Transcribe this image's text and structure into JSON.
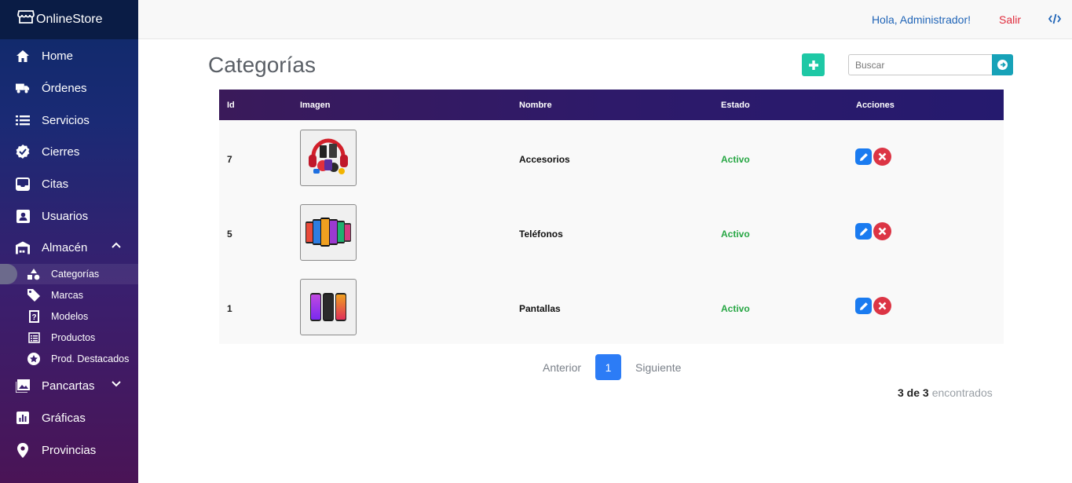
{
  "app": {
    "brand": "OnlineStore"
  },
  "colors": {
    "accent": "#1ec8a5",
    "primary": "#2c7cf6",
    "status_active": "#28a745",
    "danger": "#dc3545"
  },
  "sidebar": {
    "items": [
      {
        "label": "Home",
        "icon": "home-icon"
      },
      {
        "label": "Órdenes",
        "icon": "truck-icon"
      },
      {
        "label": "Servicios",
        "icon": "list-icon"
      },
      {
        "label": "Cierres",
        "icon": "badge-check-icon"
      },
      {
        "label": "Citas",
        "icon": "inbox-icon"
      },
      {
        "label": "Usuarios",
        "icon": "user-card-icon"
      },
      {
        "label": "Almacén",
        "icon": "warehouse-icon",
        "expanded": true
      },
      {
        "label": "Pancartas",
        "icon": "image-icon",
        "expanded": false
      },
      {
        "label": "Gráficas",
        "icon": "chart-icon"
      },
      {
        "label": "Provincias",
        "icon": "map-pin-icon"
      }
    ],
    "subitems": [
      {
        "label": "Categorías",
        "icon": "shapes-icon",
        "active": true
      },
      {
        "label": "Marcas",
        "icon": "tag-icon"
      },
      {
        "label": "Modelos",
        "icon": "box-question-icon"
      },
      {
        "label": "Productos",
        "icon": "list-alt-icon"
      },
      {
        "label": "Prod. Destacados",
        "icon": "star-circle-icon"
      }
    ]
  },
  "topbar": {
    "greeting": "Hola, Administrador!",
    "logout": "Salir"
  },
  "main": {
    "title": "Categorías",
    "search_placeholder": "Buscar",
    "table": {
      "headers": [
        "Id",
        "Imagen",
        "Nombre",
        "Estado",
        "Acciones"
      ],
      "rows": [
        {
          "id": "7",
          "name": "Accesorios",
          "status": "Activo",
          "image": "accessories-thumbnail"
        },
        {
          "id": "5",
          "name": "Teléfonos",
          "status": "Activo",
          "image": "phones-thumbnail"
        },
        {
          "id": "1",
          "name": "Pantallas",
          "status": "Activo",
          "image": "screens-thumbnail"
        }
      ]
    },
    "pagination": {
      "prev": "Anterior",
      "current": "1",
      "next": "Siguiente"
    },
    "found": {
      "count": "3 de 3",
      "label": "encontrados"
    }
  }
}
